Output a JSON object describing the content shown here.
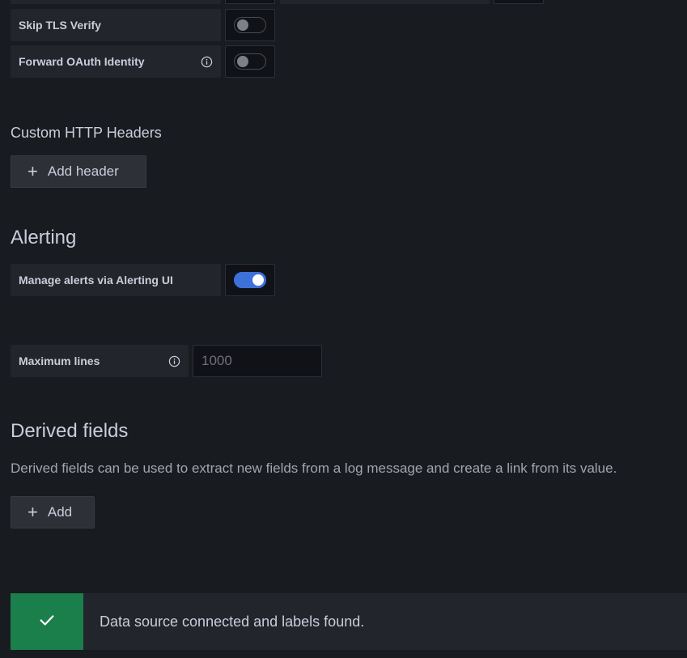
{
  "auth_settings": {
    "skip_tls_label": "Skip TLS Verify",
    "skip_tls_enabled": false,
    "forward_oauth_label": "Forward OAuth Identity",
    "forward_oauth_enabled": false,
    "info_icon": "info-icon"
  },
  "custom_headers": {
    "title": "Custom HTTP Headers",
    "add_button_label": "Add header",
    "plus_icon": "plus-icon"
  },
  "alerting": {
    "title": "Alerting",
    "manage_label": "Manage alerts via Alerting UI",
    "manage_enabled": true
  },
  "max_lines": {
    "label": "Maximum lines",
    "placeholder": "1000",
    "value": ""
  },
  "derived_fields": {
    "title": "Derived fields",
    "description": "Derived fields can be used to extract new fields from a log message and create a link from its value.",
    "add_button_label": "Add"
  },
  "status_alert": {
    "message": "Data source connected and labels found.",
    "icon": "check-icon",
    "color": "#1a7f4b"
  },
  "colors": {
    "background": "#181b1f",
    "accent": "#3d71d9",
    "success": "#1a7f4b"
  }
}
